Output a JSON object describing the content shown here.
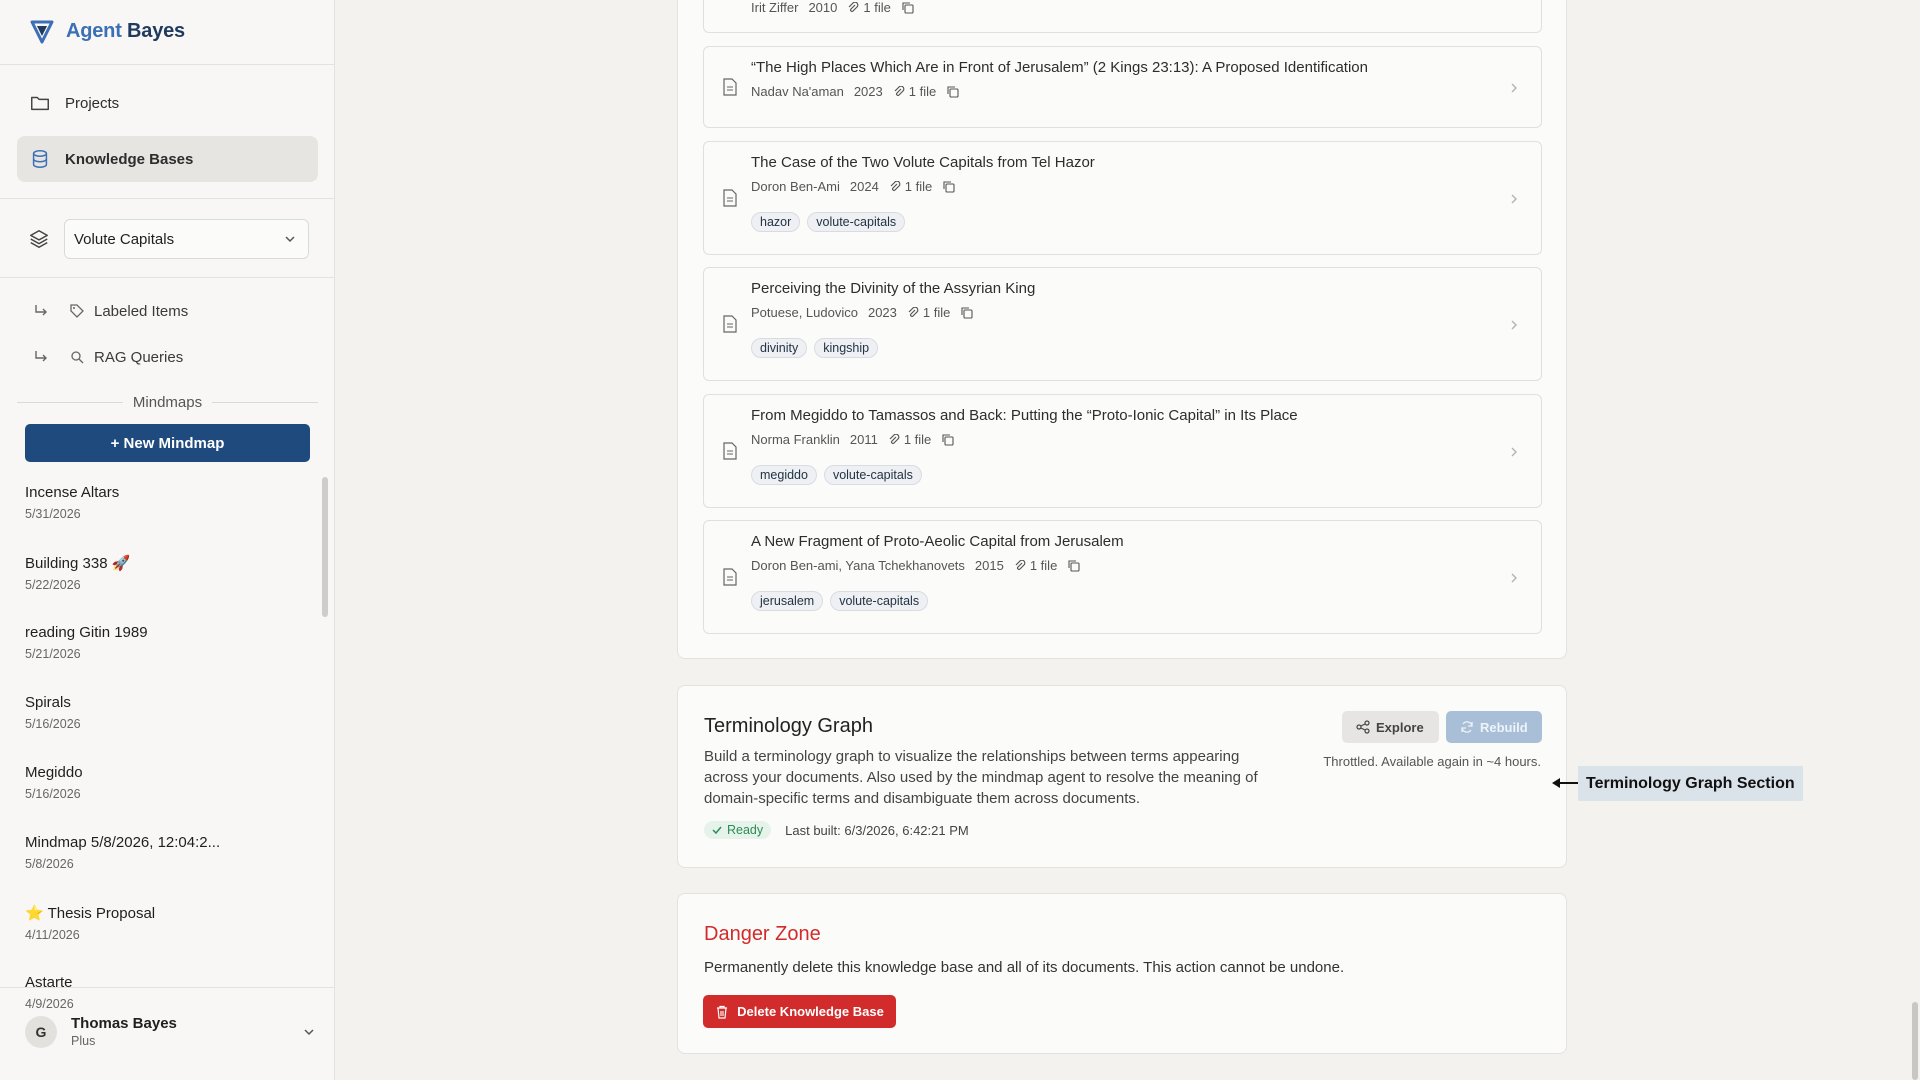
{
  "app": {
    "name_prefix": "Agent",
    "name_suffix": "Bayes"
  },
  "nav": {
    "projects": "Projects",
    "knowledge_bases": "Knowledge Bases"
  },
  "kb_select": {
    "value": "Volute Capitals"
  },
  "sub_nav": {
    "labeled_items": "Labeled Items",
    "rag_queries": "RAG Queries"
  },
  "mindmaps": {
    "header": "Mindmaps",
    "new_button": "+ New Mindmap",
    "items": [
      {
        "title": "Incense Altars",
        "date": "5/31/2026"
      },
      {
        "title": "Building 338 🚀",
        "date": "5/22/2026"
      },
      {
        "title": "reading Gitin 1989",
        "date": "5/21/2026"
      },
      {
        "title": "Spirals",
        "date": "5/16/2026"
      },
      {
        "title": "Megiddo",
        "date": "5/16/2026"
      },
      {
        "title": "Mindmap 5/8/2026, 12:04:2...",
        "date": "5/8/2026"
      },
      {
        "title": "⭐ Thesis Proposal",
        "date": "4/11/2026"
      },
      {
        "title": "Astarte",
        "date": "4/9/2026"
      }
    ]
  },
  "user": {
    "initial": "G",
    "name": "Thomas Bayes",
    "plan": "Plus"
  },
  "documents": [
    {
      "title": "",
      "authors": "Irit Ziffer",
      "year": "2010",
      "files": "1 file",
      "tags": []
    },
    {
      "title": "“The High Places Which Are in Front of Jerusalem” (2 Kings 23:13): A Proposed Identification",
      "authors": "Nadav Na'aman",
      "year": "2023",
      "files": "1 file",
      "tags": []
    },
    {
      "title": "The Case of the Two Volute Capitals from Tel Hazor",
      "authors": "Doron Ben-Ami",
      "year": "2024",
      "files": "1 file",
      "tags": [
        "hazor",
        "volute-capitals"
      ]
    },
    {
      "title": "Perceiving the Divinity of the Assyrian King",
      "authors": "Potuese, Ludovico",
      "year": "2023",
      "files": "1 file",
      "tags": [
        "divinity",
        "kingship"
      ]
    },
    {
      "title": "From Megiddo to Tamassos and Back: Putting the “Proto-Ionic Capital” in Its Place",
      "authors": "Norma Franklin",
      "year": "2011",
      "files": "1 file",
      "tags": [
        "megiddo",
        "volute-capitals"
      ]
    },
    {
      "title": "A New Fragment of Proto-Aeolic Capital from Jerusalem",
      "authors": "Doron Ben-ami, Yana Tchekhanovets",
      "year": "2015",
      "files": "1 file",
      "tags": [
        "jerusalem",
        "volute-capitals"
      ]
    }
  ],
  "terminology": {
    "title": "Terminology Graph",
    "description_1": "Build a terminology graph to visualize the relationships between terms appearing",
    "description_2": "across your documents. Also used by the mindmap agent to resolve the meaning of",
    "description_3": "domain-specific terms and disambiguate them across documents.",
    "explore_label": "Explore",
    "rebuild_label": "Rebuild",
    "throttle_note": "Throttled. Available again in ~4 hours.",
    "status": "Ready",
    "last_built": "Last built: 6/3/2026, 6:42:21 PM"
  },
  "danger": {
    "title": "Danger Zone",
    "description": "Permanently delete this knowledge base and all of its documents. This action cannot be undone.",
    "delete_label": "Delete Knowledge Base"
  },
  "annotation": {
    "label": "Terminology Graph Section"
  },
  "colors": {
    "accent": "#1e4a7d",
    "danger": "#d12b2b",
    "ready": "#2e8b57"
  }
}
